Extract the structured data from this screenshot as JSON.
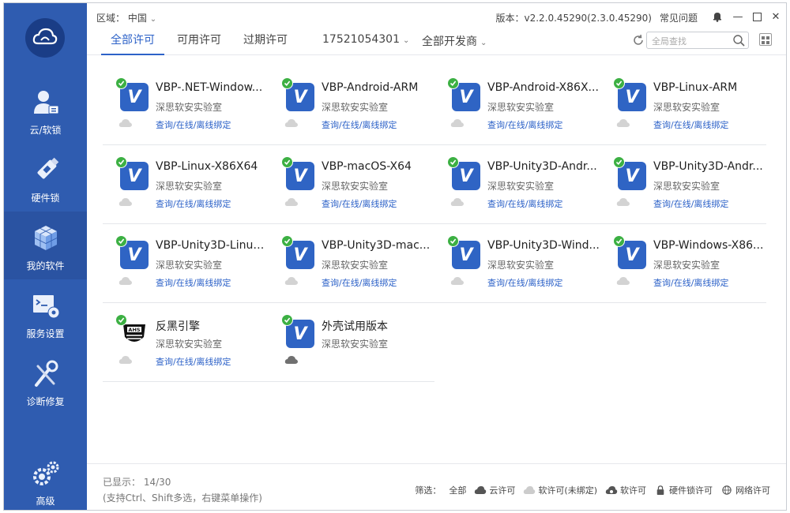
{
  "topbar": {
    "region_label": "区域：",
    "region_value": "中国",
    "version": "版本：v2.2.0.45290(2.3.0.45290)",
    "faq": "常见问题",
    "tabs": [
      "全部许可",
      "可用许可",
      "过期许可"
    ],
    "account": "17521054301",
    "developer_filter": "全部开发商",
    "search_placeholder": "全局查找"
  },
  "sidebar": {
    "items": [
      {
        "label": "云/软锁",
        "icon": "user-lock-icon"
      },
      {
        "label": "硬件锁",
        "icon": "usb-key-icon"
      },
      {
        "label": "我的软件",
        "icon": "cube-icon"
      },
      {
        "label": "服务设置",
        "icon": "terminal-settings-icon"
      },
      {
        "label": "诊断修复",
        "icon": "repair-tools-icon"
      }
    ],
    "advanced": {
      "label": "高级",
      "icon": "gears-icon"
    }
  },
  "cards": [
    {
      "name": "VBP-.NET-Window...",
      "vendor": "深思软安实验室",
      "bind": "查询/在线/离线绑定"
    },
    {
      "name": "VBP-Android-ARM",
      "vendor": "深思软安实验室",
      "bind": "查询/在线/离线绑定"
    },
    {
      "name": "VBP-Android-X86X...",
      "vendor": "深思软安实验室",
      "bind": "查询/在线/离线绑定"
    },
    {
      "name": "VBP-Linux-ARM",
      "vendor": "深思软安实验室",
      "bind": "查询/在线/离线绑定"
    },
    {
      "name": "VBP-Linux-X86X64",
      "vendor": "深思软安实验室",
      "bind": "查询/在线/离线绑定"
    },
    {
      "name": "VBP-macOS-X64",
      "vendor": "深思软安实验室",
      "bind": "查询/在线/离线绑定"
    },
    {
      "name": "VBP-Unity3D-Andr...",
      "vendor": "深思软安实验室",
      "bind": "查询/在线/离线绑定"
    },
    {
      "name": "VBP-Unity3D-Andr...",
      "vendor": "深思软安实验室",
      "bind": "查询/在线/离线绑定"
    },
    {
      "name": "VBP-Unity3D-Linux...",
      "vendor": "深思软安实验室",
      "bind": "查询/在线/离线绑定"
    },
    {
      "name": "VBP-Unity3D-mac...",
      "vendor": "深思软安实验室",
      "bind": "查询/在线/离线绑定"
    },
    {
      "name": "VBP-Unity3D-Wind...",
      "vendor": "深思软安实验室",
      "bind": "查询/在线/离线绑定"
    },
    {
      "name": "VBP-Windows-X86...",
      "vendor": "深思软安实验室",
      "bind": "查询/在线/离线绑定"
    },
    {
      "name": "反黑引擎",
      "vendor": "深思软安实验室",
      "bind": "查询/在线/离线绑定",
      "icon_text": "AHS"
    },
    {
      "name": "外壳试用版本",
      "vendor": "深思软安实验室",
      "bind": ""
    }
  ],
  "footer": {
    "shown": "已显示：  14/30",
    "hint": "(支持Ctrl、Shift多选，右键菜单操作)",
    "filter_label": "筛选：",
    "filter_all": "全部",
    "filter_cloud": "云许可",
    "filter_soft_unbound": "软许可(未绑定)",
    "filter_soft": "软许可",
    "filter_hardware": "硬件锁许可",
    "filter_network": "网络许可"
  },
  "colors": {
    "sidebar": "#2f5cb0",
    "accent": "#2d62c8",
    "check": "#3cb043"
  }
}
